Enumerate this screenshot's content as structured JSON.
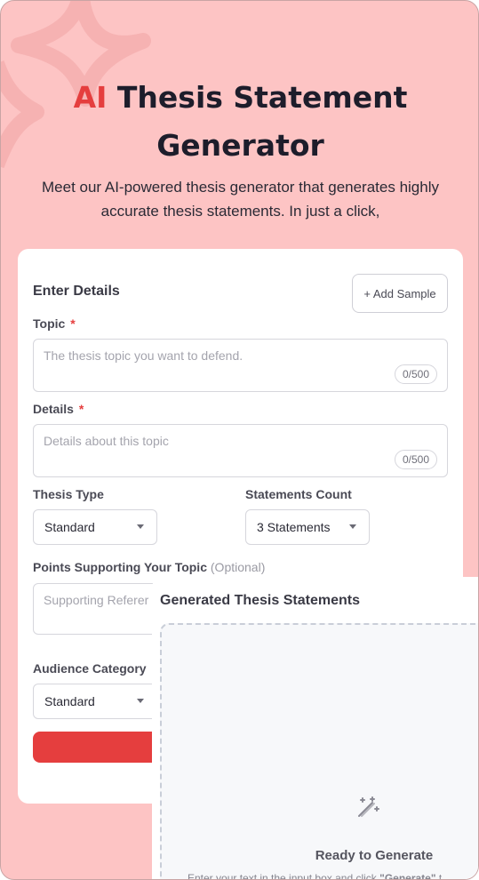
{
  "hero": {
    "title_accent": "AI",
    "title_rest_line1": "Thesis Statement",
    "title_line2": "Generator",
    "subtitle": "Meet our AI-powered thesis generator that generates highly accurate thesis statements. In just a click,"
  },
  "form": {
    "heading": "Enter Details",
    "add_sample_label": "+ Add Sample",
    "topic": {
      "label": "Topic",
      "required_mark": "*",
      "placeholder": "The thesis topic you want to defend.",
      "counter": "0/500"
    },
    "details": {
      "label": "Details",
      "required_mark": "*",
      "placeholder": "Details about this topic",
      "counter": "0/500"
    },
    "thesis_type": {
      "label": "Thesis Type",
      "value": "Standard"
    },
    "statements_count": {
      "label": "Statements Count",
      "value": "3 Statements"
    },
    "supporting_points": {
      "label": "Points Supporting Your Topic",
      "optional": "(Optional)",
      "placeholder": "Supporting Referer"
    },
    "audience": {
      "label": "Audience Category",
      "value": "Standard"
    }
  },
  "output": {
    "title": "Generated Thesis Statements",
    "icon": "magic-wand-icon",
    "ready_text": "Ready to Generate",
    "hint_prefix": "Enter your text in the input box and click ",
    "hint_bold": "\"Generate\"",
    "hint_suffix": " t"
  },
  "colors": {
    "background": "#fdc4c4",
    "accent": "#e53e3e",
    "card": "#ffffff"
  }
}
